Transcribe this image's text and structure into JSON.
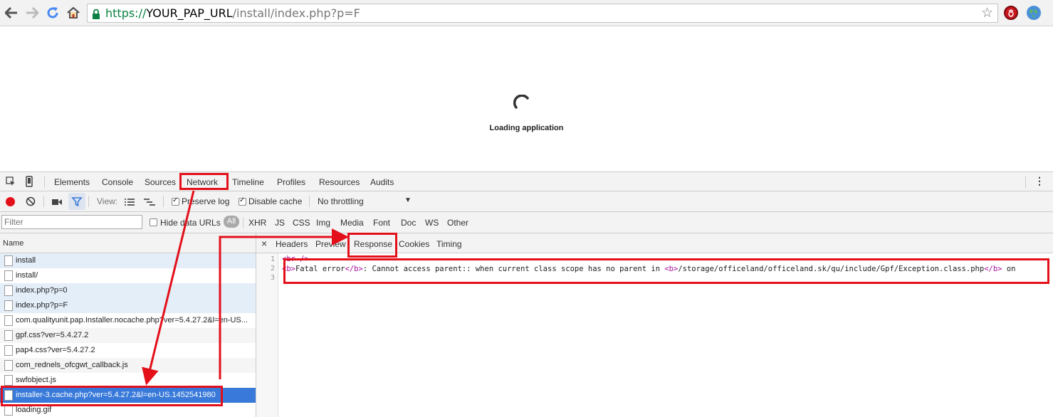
{
  "browser": {
    "url_scheme": "https://",
    "url_host": "YOUR_PAP_URL",
    "url_path": "/install/index.php?p=F",
    "icons": [
      "back-icon",
      "forward-icon",
      "reload-icon",
      "home-icon",
      "lock-icon",
      "star-icon",
      "adblock-icon",
      "globe-icon"
    ]
  },
  "page": {
    "loading_text": "Loading application"
  },
  "devtools": {
    "tabs": [
      "Elements",
      "Console",
      "Sources",
      "Network",
      "Timeline",
      "Profiles",
      "Resources",
      "Audits"
    ],
    "active_tab": "Network",
    "toolbar": {
      "view_label": "View:",
      "preserve_log": "Preserve log",
      "disable_cache": "Disable cache",
      "throttling": "No throttling"
    },
    "filter": {
      "placeholder": "Filter",
      "hide_data_urls": "Hide data URLs",
      "types": [
        "All",
        "XHR",
        "JS",
        "CSS",
        "Img",
        "Media",
        "Font",
        "Doc",
        "WS",
        "Other"
      ]
    },
    "requests": {
      "column_name": "Name",
      "rows": [
        "install",
        "install/",
        "index.php?p=0",
        "index.php?p=F",
        "com.qualityunit.pap.Installer.nocache.php?ver=5.4.27.2&l=en-US...",
        "gpf.css?ver=5.4.27.2",
        "pap4.css?ver=5.4.27.2",
        "com_rednels_ofcgwt_callback.js",
        "swfobject.js",
        "installer-3.cache.php?ver=5.4.27.2&l=en-US.1452541980",
        "loading.gif"
      ]
    },
    "response": {
      "close": "×",
      "tabs": [
        "Headers",
        "Preview",
        "Response",
        "Cookies",
        "Timing"
      ],
      "active_tab": "Response",
      "line_numbers": [
        "1",
        "2",
        "3"
      ],
      "line1": "<br />",
      "line2_b_open": "<b>",
      "line2_fatal": "Fatal error",
      "line2_b_close": "</b>",
      "line2_msg": ":  Cannot access parent:: when current class scope has no parent in ",
      "line2_b_open2": "<b>",
      "line2_path": "/storage/officeland/officeland.sk/qu/include/Gpf/Exception.class.php",
      "line2_b_close2": "</b>",
      "line2_tail": " on"
    }
  },
  "colors": {
    "annotation": "#e3101a",
    "selection": "#3879d9"
  }
}
